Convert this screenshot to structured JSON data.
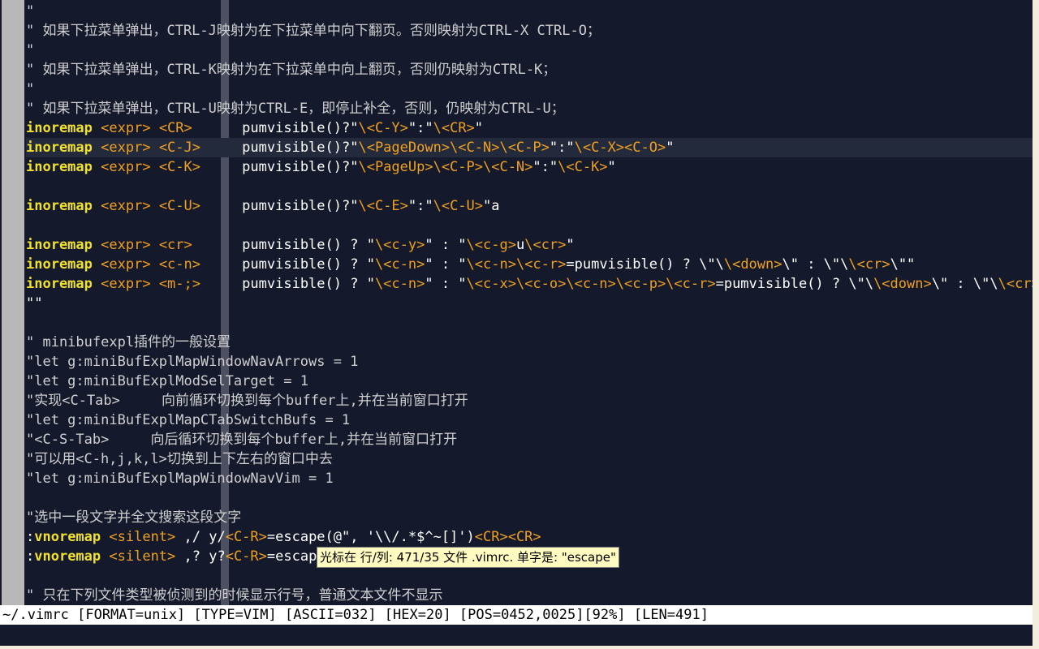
{
  "editor": {
    "lines": [
      [
        {
          "t": "\"",
          "k": "c"
        }
      ],
      [
        {
          "t": "\" 如果下拉菜单弹出，CTRL-J映射为在下拉菜单中向下翻页。否则映射为CTRL-X CTRL-O；",
          "k": "c"
        }
      ],
      [
        {
          "t": "\"",
          "k": "c"
        }
      ],
      [
        {
          "t": "\" 如果下拉菜单弹出，CTRL-K映射为在下拉菜单中向上翻页，否则仍映射为CTRL-K；",
          "k": "c"
        }
      ],
      [
        {
          "t": "\"",
          "k": "c"
        }
      ],
      [
        {
          "t": "\" 如果下拉菜单弹出，CTRL-U映射为CTRL-E，即停止补全，否则，仍映射为CTRL-U；",
          "k": "c"
        }
      ],
      [
        {
          "t": "inoremap",
          "k": "kw"
        },
        {
          "t": " ",
          "k": "fn"
        },
        {
          "t": "<expr>",
          "k": "sp"
        },
        {
          "t": " ",
          "k": "fn"
        },
        {
          "t": "<CR>",
          "k": "sp"
        },
        {
          "t": "      pumvisible()?\"",
          "k": "fn"
        },
        {
          "t": "\\<C-Y>",
          "k": "sp"
        },
        {
          "t": "\":\"",
          "k": "fn"
        },
        {
          "t": "\\<CR>",
          "k": "sp"
        },
        {
          "t": "\"",
          "k": "fn"
        }
      ],
      [
        {
          "t": "inoremap",
          "k": "kw"
        },
        {
          "t": " ",
          "k": "fn"
        },
        {
          "t": "<expr>",
          "k": "sp"
        },
        {
          "t": " ",
          "k": "fn"
        },
        {
          "t": "<C-J>",
          "k": "sp"
        },
        {
          "t": "     pumvisible()?\"",
          "k": "fn"
        },
        {
          "t": "\\<PageDown>\\<C-N>\\<C-P>",
          "k": "sp"
        },
        {
          "t": "\":\"",
          "k": "fn"
        },
        {
          "t": "\\<C-X><C-O>",
          "k": "sp"
        },
        {
          "t": "\"",
          "k": "fn"
        }
      ],
      [
        {
          "t": "inoremap",
          "k": "kw"
        },
        {
          "t": " ",
          "k": "fn"
        },
        {
          "t": "<expr>",
          "k": "sp"
        },
        {
          "t": " ",
          "k": "fn"
        },
        {
          "t": "<C-K>",
          "k": "sp"
        },
        {
          "t": "     pumvisible()?\"",
          "k": "fn"
        },
        {
          "t": "\\<PageUp>\\<C-P>\\<C-N>",
          "k": "sp"
        },
        {
          "t": "\":\"",
          "k": "fn"
        },
        {
          "t": "\\<C-K>",
          "k": "sp"
        },
        {
          "t": "\"",
          "k": "fn"
        }
      ],
      [],
      [
        {
          "t": "inoremap",
          "k": "kw"
        },
        {
          "t": " ",
          "k": "fn"
        },
        {
          "t": "<expr>",
          "k": "sp"
        },
        {
          "t": " ",
          "k": "fn"
        },
        {
          "t": "<C-U>",
          "k": "sp"
        },
        {
          "t": "     pumvisible()?\"",
          "k": "fn"
        },
        {
          "t": "\\<C-E>",
          "k": "sp"
        },
        {
          "t": "\":\"",
          "k": "fn"
        },
        {
          "t": "\\<C-U>",
          "k": "sp"
        },
        {
          "t": "\"a",
          "k": "fn"
        }
      ],
      [],
      [
        {
          "t": "inoremap",
          "k": "kw"
        },
        {
          "t": " ",
          "k": "fn"
        },
        {
          "t": "<expr>",
          "k": "sp"
        },
        {
          "t": " ",
          "k": "fn"
        },
        {
          "t": "<cr>",
          "k": "sp"
        },
        {
          "t": "      pumvisible() ? \"",
          "k": "fn"
        },
        {
          "t": "\\<c-y>",
          "k": "sp"
        },
        {
          "t": "\" : \"",
          "k": "fn"
        },
        {
          "t": "\\<c-g>",
          "k": "sp"
        },
        {
          "t": "u",
          "k": "fn"
        },
        {
          "t": "\\<cr>",
          "k": "sp"
        },
        {
          "t": "\"",
          "k": "fn"
        }
      ],
      [
        {
          "t": "inoremap",
          "k": "kw"
        },
        {
          "t": " ",
          "k": "fn"
        },
        {
          "t": "<expr>",
          "k": "sp"
        },
        {
          "t": " ",
          "k": "fn"
        },
        {
          "t": "<c-n>",
          "k": "sp"
        },
        {
          "t": "     pumvisible() ? \"",
          "k": "fn"
        },
        {
          "t": "\\<c-n>",
          "k": "sp"
        },
        {
          "t": "\" : \"",
          "k": "fn"
        },
        {
          "t": "\\<c-n>\\<c-r>",
          "k": "sp"
        },
        {
          "t": "=pumvisible() ? \\\"\\",
          "k": "fn"
        },
        {
          "t": "\\<down>",
          "k": "sp"
        },
        {
          "t": "\\\" : \\\"\\",
          "k": "fn"
        },
        {
          "t": "\\<cr>",
          "k": "sp"
        },
        {
          "t": "\\\"\"",
          "k": "fn"
        }
      ],
      [
        {
          "t": "inoremap",
          "k": "kw"
        },
        {
          "t": " ",
          "k": "fn"
        },
        {
          "t": "<expr>",
          "k": "sp"
        },
        {
          "t": " ",
          "k": "fn"
        },
        {
          "t": "<m-;>",
          "k": "sp"
        },
        {
          "t": "     pumvisible() ? \"",
          "k": "fn"
        },
        {
          "t": "\\<c-n>",
          "k": "sp"
        },
        {
          "t": "\" : \"",
          "k": "fn"
        },
        {
          "t": "\\<c-x>\\<c-o>\\<c-n>\\<c-p>\\<c-r>",
          "k": "sp"
        },
        {
          "t": "=pumvisible() ? \\\"\\",
          "k": "fn"
        },
        {
          "t": "\\<down>",
          "k": "sp"
        },
        {
          "t": "\\\" : \\\"\\",
          "k": "fn"
        },
        {
          "t": "\\<cr>\\",
          "k": "sp"
        }
      ],
      [
        {
          "t": "\"\"",
          "k": "fn"
        }
      ],
      [],
      [
        {
          "t": "\" minibufexpl插件的一般设置",
          "k": "c"
        }
      ],
      [
        {
          "t": "\"let g:miniBufExplMapWindowNavArrows = 1",
          "k": "c"
        }
      ],
      [
        {
          "t": "\"let g:miniBufExplModSelTarget = 1",
          "k": "c"
        }
      ],
      [
        {
          "t": "\"实现<C-Tab>     向前循环切换到每个buffer上,并在当前窗口打开",
          "k": "c"
        }
      ],
      [
        {
          "t": "\"let g:miniBufExplMapCTabSwitchBufs = 1",
          "k": "c"
        }
      ],
      [
        {
          "t": "\"<C-S-Tab>     向后循环切换到每个buffer上,并在当前窗口打开",
          "k": "c"
        }
      ],
      [
        {
          "t": "\"可以用<C-h,j,k,l>切换到上下左右的窗口中去",
          "k": "c"
        }
      ],
      [
        {
          "t": "\"let g:miniBufExplMapWindowNavVim = 1",
          "k": "c"
        }
      ],
      [],
      [
        {
          "t": "\"选中一段文字并全文搜索这段文字",
          "k": "c"
        }
      ],
      [
        {
          "t": ":",
          "k": "fn"
        },
        {
          "t": "vnoremap",
          "k": "kw"
        },
        {
          "t": " ",
          "k": "fn"
        },
        {
          "t": "<silent>",
          "k": "sp"
        },
        {
          "t": " ,/ y/",
          "k": "fn"
        },
        {
          "t": "<C-R>",
          "k": "sp"
        },
        {
          "t": "=escape(@\", '\\\\/.*$^~[]')",
          "k": "fn"
        },
        {
          "t": "<CR><CR>",
          "k": "sp"
        }
      ],
      [
        {
          "t": ":",
          "k": "fn"
        },
        {
          "t": "vnoremap",
          "k": "kw"
        },
        {
          "t": " ",
          "k": "fn"
        },
        {
          "t": "<silent>",
          "k": "sp"
        },
        {
          "t": " ,? y?",
          "k": "fn"
        },
        {
          "t": "<C-R>",
          "k": "sp"
        },
        {
          "t": "=escape",
          "k": "fn"
        }
      ],
      [],
      [
        {
          "t": "\" 只在下列文件类型被侦测到的时候显示行号，普通文本文件不显示",
          "k": "c"
        }
      ]
    ]
  },
  "tooltip": {
    "text": "光标在 行/列: 471/35 文件 .vimrc. 单字是: \"escape\""
  },
  "statusbar": {
    "text": "~/.vimrc [FORMAT=unix] [TYPE=VIM] [ASCII=032] [HEX=20] [POS=0452,0025][92%] [LEN=491]"
  },
  "colors": {
    "background": "#141a2c",
    "comment": "#cfcfcf",
    "keyword": "#f0e030",
    "special": "#f0a020",
    "text": "#ffffff"
  }
}
